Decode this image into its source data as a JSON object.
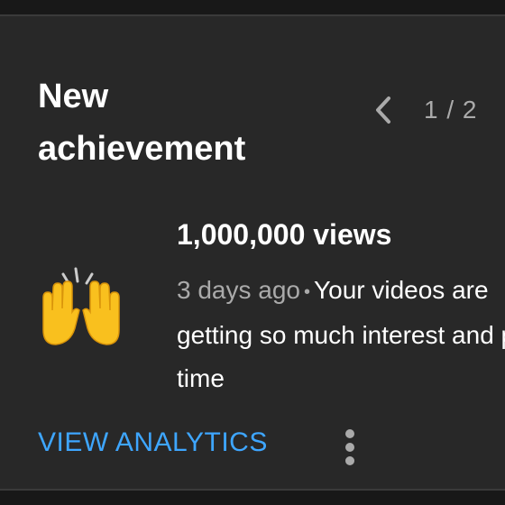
{
  "card": {
    "title": "New achievement",
    "pager": {
      "current_text": "1 / 2",
      "prev_icon": "chevron-left-icon"
    }
  },
  "achievement": {
    "emoji_icon": "raising-hands-icon",
    "title": "1,000,000 views",
    "time_ago": "3 days ago",
    "separator": "•",
    "description": "Your videos are getting so much interest and play time"
  },
  "actions": {
    "analytics_label": "VIEW ANALYTICS",
    "more_icon": "more-vertical-icon"
  },
  "colors": {
    "background": "#181818",
    "card": "#282828",
    "text": "#ffffff",
    "secondary_text": "#aaaaaa",
    "link": "#3ea6ff",
    "emoji_yellow": "#f9c01e"
  }
}
